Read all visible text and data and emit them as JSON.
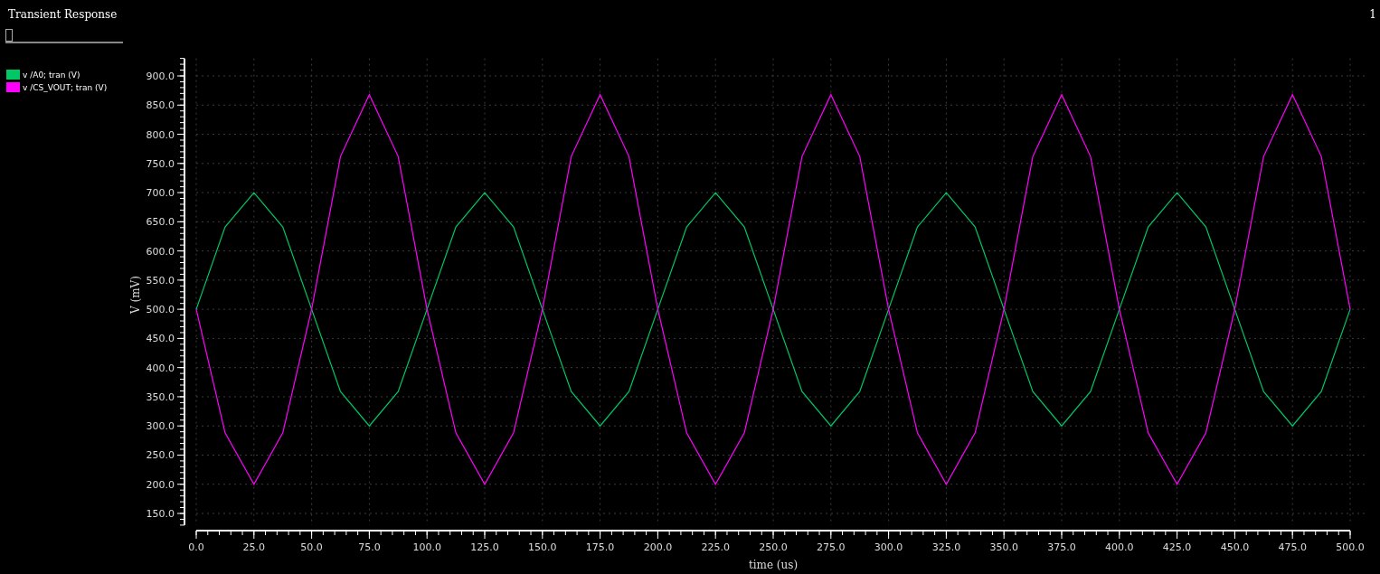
{
  "window": {
    "title": "Transient Response",
    "page_number": "1"
  },
  "slider": {
    "level": 0
  },
  "chart_data": {
    "type": "line",
    "xlabel": "time (us)",
    "ylabel": "V (mV)",
    "x": [
      0,
      12.5,
      25,
      37.5,
      50,
      62.5,
      75,
      87.5,
      100,
      112.5,
      125,
      137.5,
      150,
      162.5,
      175,
      187.5,
      200,
      212.5,
      225,
      237.5,
      250,
      262.5,
      275,
      287.5,
      300,
      312.5,
      325,
      337.5,
      350,
      362.5,
      375,
      387.5,
      400,
      412.5,
      425,
      437.5,
      450,
      462.5,
      475,
      487.5,
      500
    ],
    "series": [
      {
        "name": "v /A0; tran (V)",
        "color": "#00c864",
        "values": [
          500,
          641,
          700,
          641,
          500,
          359,
          300,
          359,
          500,
          641,
          700,
          641,
          500,
          359,
          300,
          359,
          500,
          641,
          700,
          641,
          500,
          359,
          300,
          359,
          500,
          641,
          700,
          641,
          500,
          359,
          300,
          359,
          500,
          641,
          700,
          641,
          500,
          359,
          300,
          359,
          500
        ]
      },
      {
        "name": "v /CS_VOUT; tran (V)",
        "color": "#ff00ff",
        "values": [
          500,
          288,
          200,
          288,
          500,
          762,
          868,
          762,
          500,
          288,
          200,
          288,
          500,
          762,
          868,
          762,
          500,
          288,
          200,
          288,
          500,
          762,
          868,
          762,
          500,
          288,
          200,
          288,
          500,
          762,
          868,
          762,
          500,
          288,
          200,
          288,
          500,
          762,
          868,
          762,
          500
        ]
      }
    ],
    "grid": true,
    "xlim": [
      0,
      500
    ],
    "ylim": [
      130,
      930
    ],
    "xticks": [
      {
        "value": 0,
        "label": "0.0"
      },
      {
        "value": 25,
        "label": "25.0"
      },
      {
        "value": 50,
        "label": "50.0"
      },
      {
        "value": 75,
        "label": "75.0"
      },
      {
        "value": 100,
        "label": "100.0"
      },
      {
        "value": 125,
        "label": "125.0"
      },
      {
        "value": 150,
        "label": "150.0"
      },
      {
        "value": 175,
        "label": "175.0"
      },
      {
        "value": 200,
        "label": "200.0"
      },
      {
        "value": 225,
        "label": "225.0"
      },
      {
        "value": 250,
        "label": "250.0"
      },
      {
        "value": 275,
        "label": "275.0"
      },
      {
        "value": 300,
        "label": "300.0"
      },
      {
        "value": 325,
        "label": "325.0"
      },
      {
        "value": 350,
        "label": "350.0"
      },
      {
        "value": 375,
        "label": "375.0"
      },
      {
        "value": 400,
        "label": "400.0"
      },
      {
        "value": 425,
        "label": "425.0"
      },
      {
        "value": 450,
        "label": "450.0"
      },
      {
        "value": 475,
        "label": "475.0"
      },
      {
        "value": 500,
        "label": "500.0"
      }
    ],
    "yticks": [
      {
        "value": 150,
        "label": "150.0"
      },
      {
        "value": 200,
        "label": "200.0"
      },
      {
        "value": 250,
        "label": "250.0"
      },
      {
        "value": 300,
        "label": "300.0"
      },
      {
        "value": 350,
        "label": "350.0"
      },
      {
        "value": 400,
        "label": "400.0"
      },
      {
        "value": 450,
        "label": "450.0"
      },
      {
        "value": 500,
        "label": "500.0"
      },
      {
        "value": 550,
        "label": "550.0"
      },
      {
        "value": 600,
        "label": "600.0"
      },
      {
        "value": 650,
        "label": "650.0"
      },
      {
        "value": 700,
        "label": "700.0"
      },
      {
        "value": 750,
        "label": "750.0"
      },
      {
        "value": 800,
        "label": "800.0"
      },
      {
        "value": 850,
        "label": "850.0"
      },
      {
        "value": 900,
        "label": "900.0"
      }
    ]
  }
}
